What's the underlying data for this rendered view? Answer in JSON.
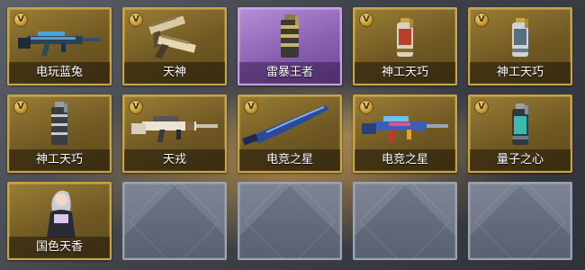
{
  "badge_letter": "V",
  "colors": {
    "gold": "#c9a542",
    "purple": "#b48fd6",
    "empty": "#6e7687"
  },
  "items": [
    {
      "name": "电玩蓝兔",
      "kind": "rifle-blue",
      "rarity": "gold",
      "vip": true
    },
    {
      "name": "天神",
      "kind": "dual-pistols",
      "rarity": "gold",
      "vip": true
    },
    {
      "name": "雷暴王者",
      "kind": "grenade",
      "rarity": "purple",
      "vip": false
    },
    {
      "name": "神工天巧",
      "kind": "grenade-red",
      "rarity": "gold",
      "vip": true
    },
    {
      "name": "神工天巧",
      "kind": "grenade-silver",
      "rarity": "gold",
      "vip": true
    },
    {
      "name": "神工天巧",
      "kind": "grenade-dark",
      "rarity": "gold",
      "vip": true
    },
    {
      "name": "天戎",
      "kind": "rifle-white",
      "rarity": "gold",
      "vip": true
    },
    {
      "name": "电竞之星",
      "kind": "knife-blue",
      "rarity": "gold",
      "vip": true
    },
    {
      "name": "电竞之星",
      "kind": "rifle-colorful",
      "rarity": "gold",
      "vip": true
    },
    {
      "name": "量子之心",
      "kind": "grenade-teal",
      "rarity": "gold",
      "vip": true
    },
    {
      "name": "国色天香",
      "kind": "character",
      "rarity": "gold",
      "vip": false
    }
  ],
  "empty_slots": 4
}
